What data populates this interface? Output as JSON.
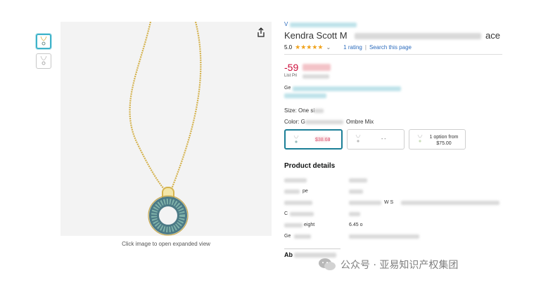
{
  "thumbnails": [
    "thumbnail-1",
    "thumbnail-2"
  ],
  "image": {
    "caption": "Click image to open expanded view"
  },
  "product": {
    "store_link": "V",
    "title_start": "Kendra Scott M",
    "title_end": "ace",
    "rating_value": "5.0",
    "stars": "★★★★★",
    "rating_chevron": "⌄",
    "ratings_count": "1 rating",
    "search_link": "Search this page",
    "discount": "-59",
    "list_price_label": "List Pri",
    "promo_label": "Ge",
    "size_label": "Size: One si",
    "color_label_start": "Color: G",
    "color_label_end": "Ombre Mix"
  },
  "options": [
    {
      "price": "$38.68"
    },
    {
      "price": "- -"
    },
    {
      "text": "1 option from $75.00"
    }
  ],
  "details": {
    "title": "Product details",
    "rows": [
      {
        "key": "",
        "value": ""
      },
      {
        "key": "pe",
        "value": ""
      },
      {
        "key": "",
        "value": "W S"
      },
      {
        "key": "C",
        "value": ""
      },
      {
        "key": "eight",
        "value": "6.45 o"
      },
      {
        "key": "Ge",
        "value": ""
      }
    ],
    "about": "Ab"
  },
  "watermark": "公众号 · 亚易知识产权集团",
  "colors": {
    "price_red": "#cc0c39",
    "link_blue": "#2b6bbd",
    "star_orange": "#f0a21b",
    "selected_border": "#1b7f97"
  }
}
